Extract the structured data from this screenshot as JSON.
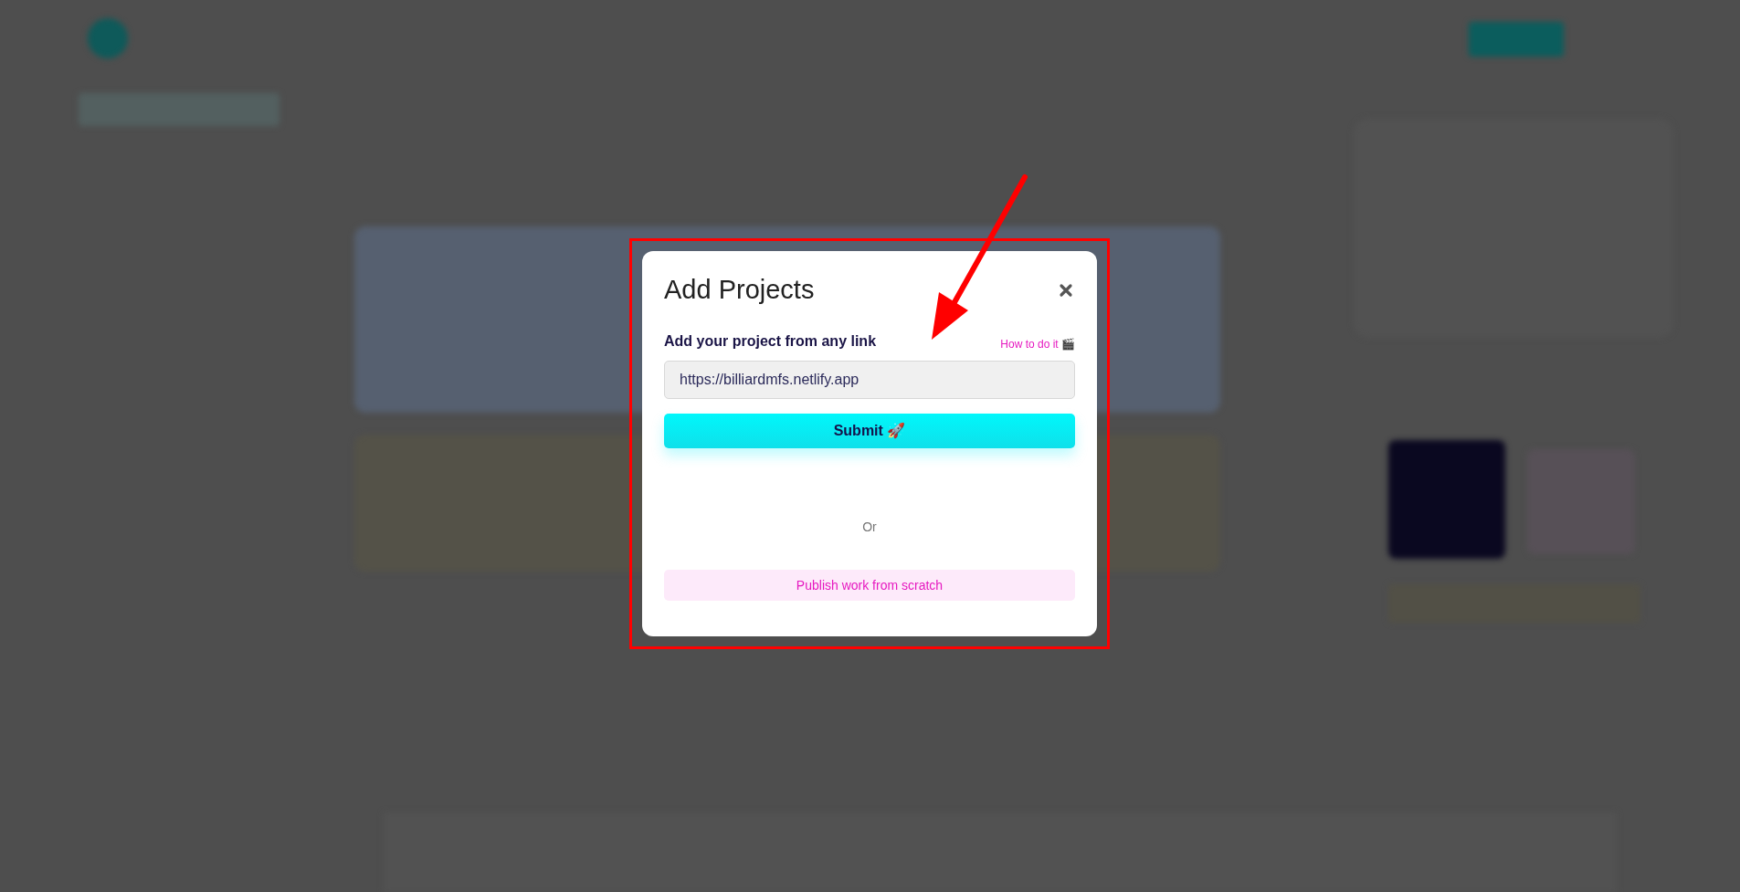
{
  "modal": {
    "title": "Add Projects",
    "field_label": "Add your project from any link",
    "help_link": "How to do it 🎬",
    "url_field": {
      "value": "https://billiardmfs.netlify.app"
    },
    "submit_button": "Submit 🚀",
    "divider_text": "Or",
    "secondary_button": "Publish work from scratch"
  }
}
